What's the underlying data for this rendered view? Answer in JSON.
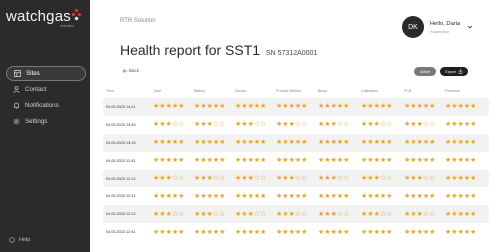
{
  "brand": {
    "logo": "watchgas",
    "logo_sub": "detection"
  },
  "sidebar": {
    "items": [
      {
        "label": "Sites",
        "icon": "grid-icon",
        "active": true
      },
      {
        "label": "Contact",
        "icon": "person-icon",
        "active": false
      },
      {
        "label": "Notifications",
        "icon": "bell-icon",
        "active": false
      },
      {
        "label": "Settings",
        "icon": "gear-icon",
        "active": false
      }
    ],
    "help": "Help"
  },
  "header": {
    "company": "RTR Solution",
    "title": "Health report for SST1",
    "serial": "SN 57312A0001"
  },
  "user": {
    "initials": "DK",
    "greeting": "Hello, Daria",
    "role": "Supervisor"
  },
  "toolbar": {
    "back": "Back",
    "active_label": "Active",
    "export_label": "Export"
  },
  "table": {
    "columns": [
      "Time",
      "Total",
      "Battery",
      "Sensor",
      "Product lifetime",
      "Bump",
      "Calibration",
      "PCB",
      "Firmware"
    ],
    "rows": [
      {
        "time": "04.05.2023 14:41",
        "ratings": [
          5,
          5,
          5,
          5,
          5,
          5,
          5,
          5
        ]
      },
      {
        "time": "04.05.2023 13:45",
        "ratings": [
          3,
          3,
          3,
          3,
          3,
          3,
          3,
          5
        ]
      },
      {
        "time": "04.05.2023 13:16",
        "ratings": [
          5,
          5,
          5,
          5,
          5,
          5,
          5,
          5
        ]
      },
      {
        "time": "04.05.2023 12:41",
        "ratings": [
          5,
          5,
          5,
          5,
          5,
          5,
          5,
          5
        ]
      },
      {
        "time": "04.05.2023 12:12",
        "ratings": [
          3,
          3,
          3,
          3,
          3,
          3,
          3,
          5
        ]
      },
      {
        "time": "04.05.2023 12:41",
        "ratings": [
          5,
          5,
          5,
          5,
          5,
          5,
          5,
          5
        ]
      },
      {
        "time": "04.05.2023 12:12",
        "ratings": [
          3,
          3,
          3,
          3,
          3,
          3,
          3,
          5
        ]
      },
      {
        "time": "04.05.2023 12:41",
        "ratings": [
          5,
          5,
          5,
          5,
          5,
          5,
          5,
          5
        ]
      }
    ]
  },
  "colors": {
    "sidebar": "#2b2b2b",
    "accent": "#d23a3a",
    "star": "#e9a817",
    "row_alt": "#f2f2f2"
  }
}
